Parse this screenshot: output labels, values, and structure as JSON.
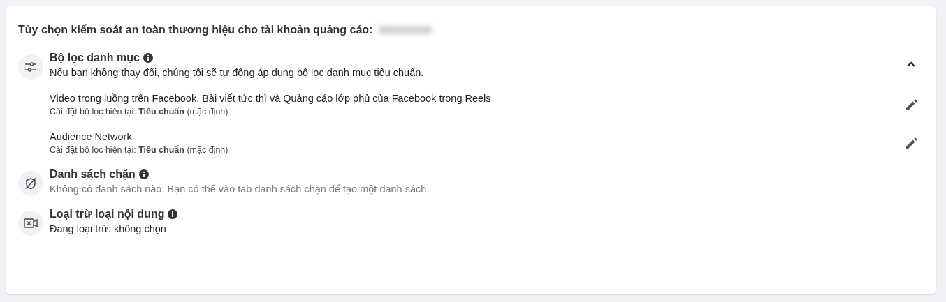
{
  "heading": "Tùy chọn kiểm soát an toàn thương hiệu cho tài khoản quảng cáo:",
  "sections": [
    {
      "kind": "filter",
      "title": "Bộ lọc danh mục",
      "description": "Nếu bạn không thay đổi, chúng tôi sẽ tự động áp dụng bộ lọc danh mục tiêu chuẩn.",
      "description_muted": false,
      "expanded": true,
      "items": [
        {
          "title": "Video trong luồng trên Facebook, Bài viết tức thì và Quảng cáo lớp phủ của Facebook trong Reels",
          "setting": "Cài đặt bộ lọc hiện tại: **Tiêu chuẩn** (mặc định)"
        },
        {
          "title": "Audience Network",
          "setting": "Cài đặt bộ lọc hiện tại: **Tiêu chuẩn** (mặc định)"
        }
      ]
    },
    {
      "kind": "blocklist",
      "title": "Danh sách chặn",
      "description": "Không có danh sách nào. Bạn có thể vào tab danh sách chặn để tạo một danh sách.",
      "description_muted": true
    },
    {
      "kind": "exclusion",
      "title": "Loại trừ loại nội dung",
      "description": "Đang loại trừ: không chọn",
      "description_muted": false
    }
  ]
}
